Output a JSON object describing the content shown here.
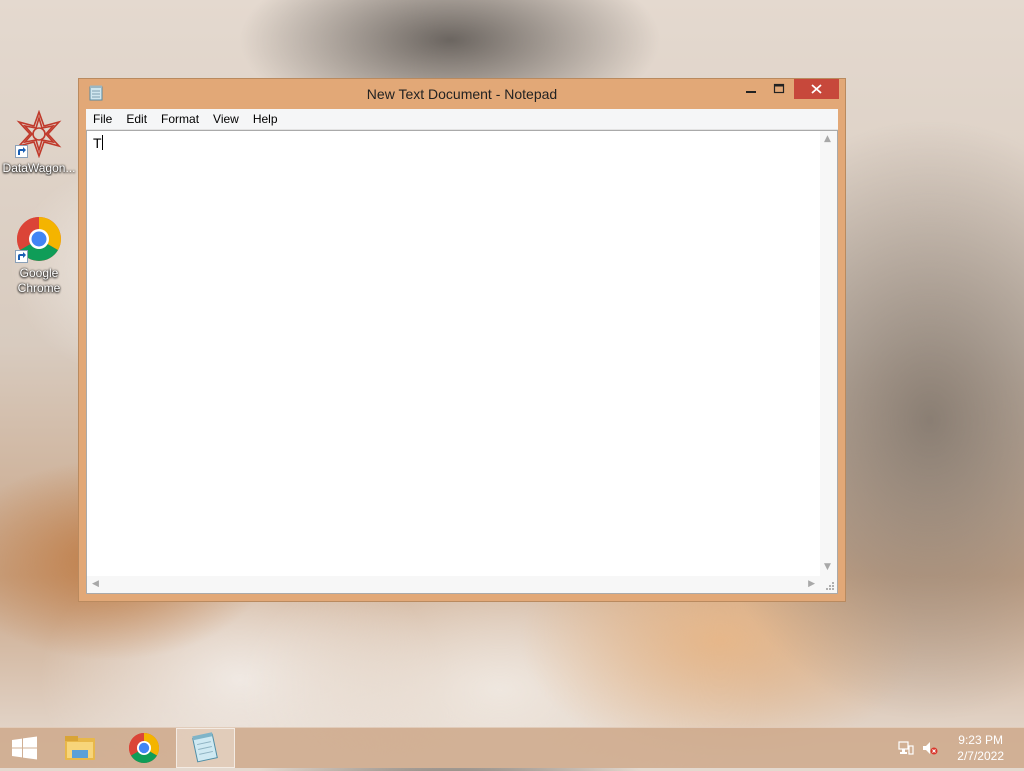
{
  "desktop": {
    "icons": [
      {
        "label": "DataWagon...",
        "icon": "datawagon-app-icon"
      },
      {
        "label": "Google Chrome",
        "icon": "chrome-icon"
      }
    ]
  },
  "window": {
    "title": "New Text Document - Notepad",
    "buttons": {
      "minimize": "—",
      "maximize": "☐",
      "close": "✕"
    },
    "menu": [
      "File",
      "Edit",
      "Format",
      "View",
      "Help"
    ],
    "content": "T"
  },
  "taskbar": {
    "items": [
      "start-button",
      "file-explorer",
      "google-chrome",
      "notepad"
    ],
    "clock": {
      "time": "9:23 PM",
      "date": "2/7/2022"
    },
    "tray": [
      "network-icon",
      "volume-muted-icon"
    ]
  },
  "colors": {
    "window_frame": "#e2a877",
    "close_button": "#c7483b",
    "taskbar": "#ceaa8c"
  }
}
